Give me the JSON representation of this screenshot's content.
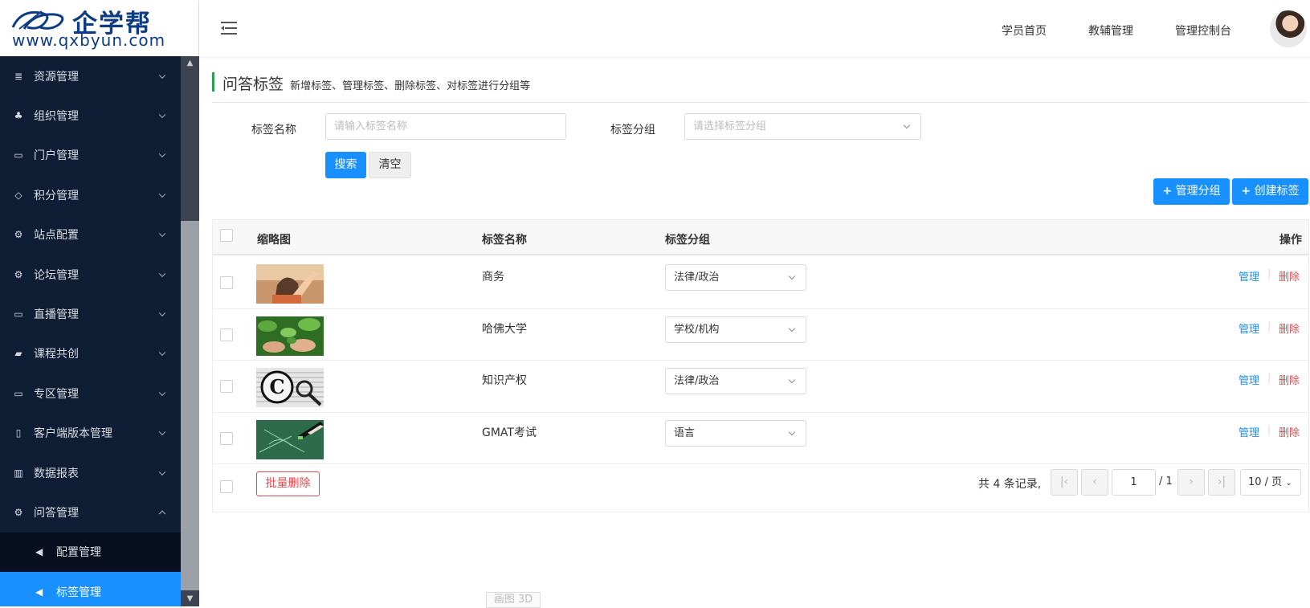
{
  "brand": {
    "name": "企学帮",
    "url": "www.qxbyun.com",
    "color": "#0e3c84"
  },
  "header": {
    "nav": [
      {
        "label": "学员首页"
      },
      {
        "label": "教辅管理"
      },
      {
        "label": "管理控制台"
      }
    ]
  },
  "sidebar": {
    "items": [
      {
        "label": "资源管理",
        "icon": "database-icon"
      },
      {
        "label": "组织管理",
        "icon": "users-icon"
      },
      {
        "label": "门户管理",
        "icon": "monitor-icon"
      },
      {
        "label": "积分管理",
        "icon": "diamond-icon"
      },
      {
        "label": "站点配置",
        "icon": "cogs-icon"
      },
      {
        "label": "论坛管理",
        "icon": "cogs-icon"
      },
      {
        "label": "直播管理",
        "icon": "monitor-icon"
      },
      {
        "label": "课程共创",
        "icon": "book-icon"
      },
      {
        "label": "专区管理",
        "icon": "monitor-icon"
      },
      {
        "label": "客户端版本管理",
        "icon": "mobile-icon"
      },
      {
        "label": "数据报表",
        "icon": "bar-chart-icon"
      },
      {
        "label": "问答管理",
        "icon": "cogs-icon",
        "expanded": true
      }
    ],
    "subitems": [
      {
        "label": "配置管理",
        "icon": "bullhorn-icon",
        "active": false
      },
      {
        "label": "标签管理",
        "icon": "bullhorn-icon",
        "active": true
      }
    ],
    "active_color": "#1890ff"
  },
  "page": {
    "title": "问答标签",
    "subtitle": "新增标签、管理标签、删除标签、对标签进行分组等"
  },
  "filters": {
    "name_label": "标签名称",
    "name_placeholder": "请输入标签名称",
    "group_label": "标签分组",
    "group_placeholder": "请选择标签分组",
    "search_label": "搜索",
    "clear_label": "清空"
  },
  "actions": {
    "manage_groups": "管理分组",
    "create_tag": "创建标签"
  },
  "table": {
    "columns": [
      "缩略图",
      "标签名称",
      "标签分组",
      "操作"
    ],
    "rows": [
      {
        "name": "商务",
        "group": "法律/政治",
        "thumb": "person-photo"
      },
      {
        "name": "哈佛大学",
        "group": "学校/机构",
        "thumb": "leaves-photo"
      },
      {
        "name": "知识产权",
        "group": "法律/政治",
        "thumb": "copyright-photo"
      },
      {
        "name": "GMAT考试",
        "group": "语言",
        "thumb": "chalkboard-photo"
      }
    ],
    "row_actions": {
      "manage": "管理",
      "delete": "删除"
    },
    "batch_delete": "批量删除"
  },
  "pagination": {
    "total_text": "共 4 条记录,",
    "current_page": "1",
    "total_pages": "/ 1",
    "page_size": "10 / 页"
  },
  "watermark": "画图 3D"
}
